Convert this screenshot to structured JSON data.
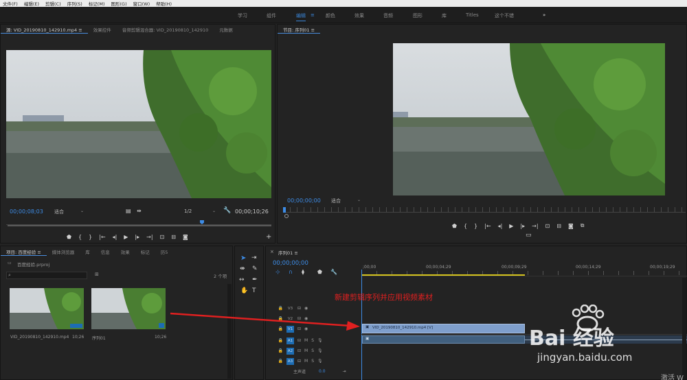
{
  "menu": [
    "文件(F)",
    "编辑(E)",
    "剪辑(C)",
    "序列(S)",
    "标记(M)",
    "图形(G)",
    "窗口(W)",
    "帮助(H)"
  ],
  "workspaces": [
    "学习",
    "组件",
    "编辑",
    "颜色",
    "效果",
    "音频",
    "图形",
    "库",
    "Titles",
    "这个不错"
  ],
  "workspace_more": "»",
  "source_tabs": [
    "源: VID_20190810_142910.mp4 ≡",
    "效果控件",
    "音频剪辑混合器: VID_20190810_142910",
    "元数据"
  ],
  "program_tab": "节目: 序列01 ≡",
  "source": {
    "timecode": "00;00;08;03",
    "fit": "适合",
    "resolution": "1/2",
    "duration": "00;00;10;26"
  },
  "program": {
    "timecode": "00;00;00;00",
    "fit": "适合"
  },
  "project": {
    "tabs": [
      "项目: 百度经验 ≡",
      "媒体浏览器",
      "库",
      "信息",
      "效果",
      "标记",
      "历5"
    ],
    "file": "百度经验.prproj",
    "count": "2 个项",
    "items": [
      {
        "name": "VID_20190810_142910.mp4",
        "duration": "10;26"
      },
      {
        "name": "序列01",
        "duration": "10;26"
      }
    ]
  },
  "timeline": {
    "tab": "序列01 ≡",
    "timecode": "00;00;00;00",
    "ruler": [
      ";00;00",
      "00;00;04;29",
      "00;00;09;29",
      "00;00;14;29",
      "00;00;19;29"
    ],
    "tracks_video": [
      "V3",
      "V2",
      "V1"
    ],
    "tracks_audio": [
      "A1",
      "A2",
      "A3"
    ],
    "master": "主声道",
    "master_val": "0.0",
    "clip_label": "VID_20190810_142910.mp4 [V]"
  },
  "annotation": "新建剪辑序列并应用视频素材",
  "watermark": {
    "brand": "Bai  经验",
    "url": "jingyan.baidu.com",
    "activate": "激活 W"
  },
  "colors": {
    "accent": "#3d8ce6",
    "annotation": "#e02020",
    "clip": "#7f9fcc"
  }
}
